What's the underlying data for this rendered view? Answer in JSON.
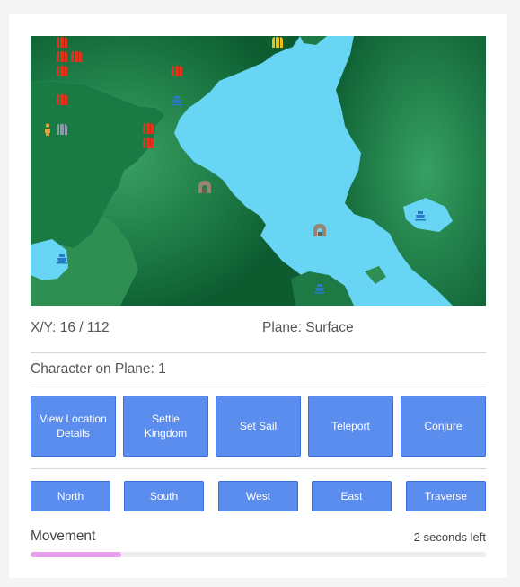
{
  "map": {
    "colors": {
      "water": "#68d5f5",
      "land_dark": "#0c5c30",
      "land_light": "#2f9a5a"
    },
    "markers": [
      {
        "icon": "red-castle-icon",
        "color": "#e0321c"
      },
      {
        "icon": "red-castle-icon",
        "color": "#e0321c"
      },
      {
        "icon": "red-castle-icon",
        "color": "#e0321c"
      },
      {
        "icon": "red-castle-icon",
        "color": "#e0321c"
      },
      {
        "icon": "red-castle-icon",
        "color": "#e0321c"
      },
      {
        "icon": "red-castle-icon",
        "color": "#e0321c"
      },
      {
        "icon": "red-castle-icon",
        "color": "#e0321c"
      },
      {
        "icon": "red-castle-icon",
        "color": "#e0321c"
      },
      {
        "icon": "yellow-castle-icon",
        "color": "#e8c21a"
      },
      {
        "icon": "grey-castle-icon",
        "color": "#8a9aa8"
      },
      {
        "icon": "character-icon",
        "color": "#e8a23a"
      },
      {
        "icon": "ship-icon",
        "color": "#2a78c8"
      },
      {
        "icon": "ship-icon",
        "color": "#2a78c8"
      },
      {
        "icon": "ship-icon",
        "color": "#2a78c8"
      },
      {
        "icon": "ship-icon",
        "color": "#2a78c8"
      },
      {
        "icon": "dungeon-gate-icon",
        "color": "#9a8470"
      },
      {
        "icon": "dungeon-gate-icon",
        "color": "#9a8470"
      }
    ]
  },
  "info": {
    "xy": "X/Y: 16 / 112",
    "plane": "Plane: Surface",
    "character": "Character on Plane: 1"
  },
  "actions": [
    {
      "label": "View Location Details"
    },
    {
      "label": "Settle Kingdom"
    },
    {
      "label": "Set Sail"
    },
    {
      "label": "Teleport"
    },
    {
      "label": "Conjure"
    }
  ],
  "directions": [
    {
      "label": "North"
    },
    {
      "label": "South"
    },
    {
      "label": "West"
    },
    {
      "label": "East"
    },
    {
      "label": "Traverse"
    }
  ],
  "movement": {
    "label": "Movement",
    "time_left": "2 seconds left",
    "progress_fraction": 0.2,
    "bar_color": "#e8a0ec"
  }
}
